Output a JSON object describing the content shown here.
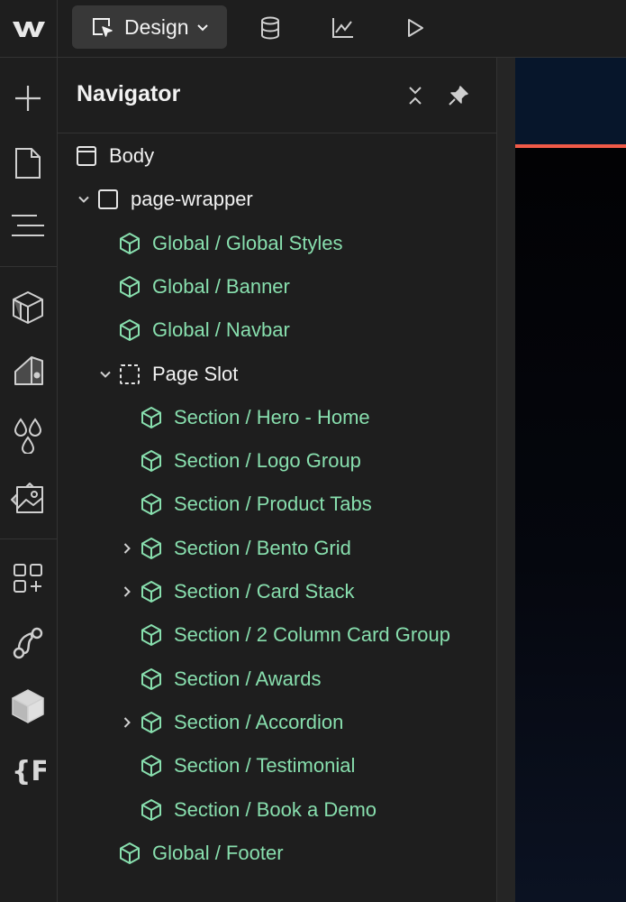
{
  "topbar": {
    "logo": "webflow-logo",
    "mode_button": {
      "label": "Design",
      "icon": "design-cursor-icon"
    },
    "icons": [
      "database-icon",
      "analyze-chart-icon",
      "preview-play-icon"
    ]
  },
  "left_toolbar": {
    "tools": [
      "add-icon",
      "pages-icon",
      "navigator-icon",
      "components-icon",
      "style-selectors-icon",
      "variables-icon",
      "assets-icon",
      "apps-icon",
      "logic-icon",
      "cms-icon",
      "finsweet-icon"
    ]
  },
  "navigator": {
    "title": "Navigator",
    "items": [
      {
        "label": "Body",
        "type": "element",
        "level": 0
      },
      {
        "label": "page-wrapper",
        "type": "element",
        "level": 1,
        "expanded": true
      },
      {
        "label": "Global / Global Styles",
        "type": "component",
        "level": 2
      },
      {
        "label": "Global / Banner",
        "type": "component",
        "level": 2
      },
      {
        "label": "Global / Navbar",
        "type": "component",
        "level": 2
      },
      {
        "label": "Page Slot",
        "type": "slot",
        "level": 2,
        "expanded": true
      },
      {
        "label": "Section / Hero - Home",
        "type": "component",
        "level": 3
      },
      {
        "label": "Section / Logo Group",
        "type": "component",
        "level": 3
      },
      {
        "label": "Section / Product Tabs",
        "type": "component",
        "level": 3
      },
      {
        "label": "Section / Bento Grid",
        "type": "component",
        "level": 3,
        "collapsed": true
      },
      {
        "label": "Section / Card Stack",
        "type": "component",
        "level": 3,
        "collapsed": true
      },
      {
        "label": "Section / 2 Column Card Group",
        "type": "component",
        "level": 3
      },
      {
        "label": "Section / Awards",
        "type": "component",
        "level": 3
      },
      {
        "label": "Section / Accordion",
        "type": "component",
        "level": 3,
        "collapsed": true
      },
      {
        "label": "Section / Testimonial",
        "type": "component",
        "level": 3
      },
      {
        "label": "Section / Book a Demo",
        "type": "component",
        "level": 3
      },
      {
        "label": "Global / Footer",
        "type": "component",
        "level": 2
      }
    ]
  },
  "colors": {
    "component_green": "#88dfae",
    "accent_red": "#f05a48",
    "panel_bg": "#1e1e1e"
  }
}
